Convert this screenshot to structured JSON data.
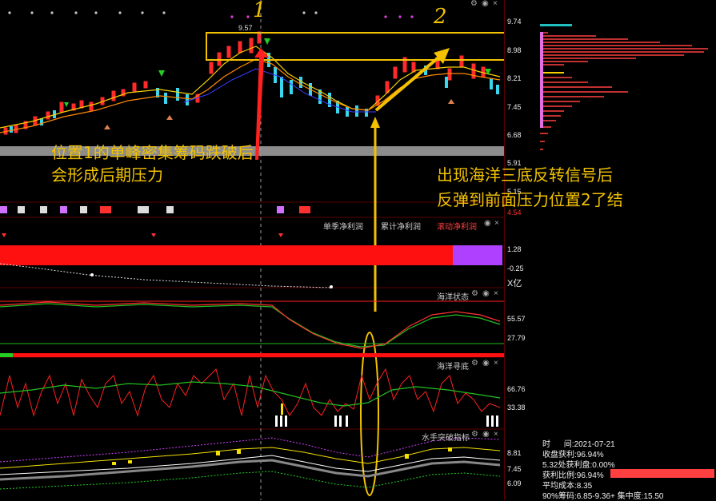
{
  "price_axis": {
    "ticks": [
      "9.74",
      "8.98",
      "8.21",
      "7.45",
      "6.68",
      "5.91",
      "5.15",
      "4.54"
    ]
  },
  "peak_label": "9.57",
  "markers": {
    "one": "1",
    "two": "2"
  },
  "annotations": {
    "left_line1": "位置1的单峰密集筹码跌破后",
    "left_line2": "会形成后期压力",
    "right_line1": "出现海洋三底反转信号后",
    "right_line2": "反弹到前面压力位置2了结"
  },
  "profit_pane": {
    "tabs": [
      "单季净利润",
      "累计净利润",
      "滚动净利润"
    ],
    "ticks": [
      "1.28",
      "-0.25"
    ],
    "unit": "X亿"
  },
  "haiyang_state": {
    "title": "海洋状态",
    "ticks": [
      "55.57",
      "27.79"
    ]
  },
  "haiyang_bottom": {
    "title": "海洋寻底",
    "ticks": [
      "66.76",
      "33.38"
    ]
  },
  "sailor": {
    "title": "水手突破指标",
    "ticks": [
      "8.81",
      "7.45",
      "6.09"
    ]
  },
  "chip_info": {
    "time_label": "时",
    "time_sep": "间:",
    "time_value": "2021-07-21",
    "profit": "收盘获利:96.94%",
    "profit_at": "5.32处获利盘:0.00%",
    "profit_ratio": "获利比例:96.94%",
    "avg_cost": "平均成本:8.35",
    "concentration": "90%筹码:6.85-9.36+ 集中度:15.50"
  },
  "colors": {
    "accent": "#f2c200",
    "up": "#ff2a2a",
    "down": "#3ad6ee",
    "profit_bar": "#ff1010",
    "profit_bar_alt": "#b040ff"
  }
}
